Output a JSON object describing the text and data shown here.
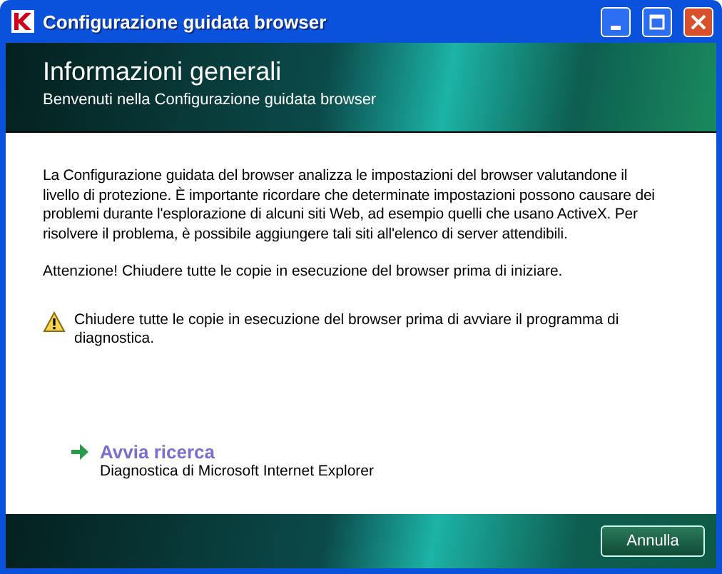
{
  "window": {
    "title": "Configurazione guidata browser"
  },
  "header": {
    "title": "Informazioni generali",
    "subtitle": "Benvenuti nella Configurazione guidata browser"
  },
  "body": {
    "intro": "La Configurazione guidata del browser analizza le impostazioni del browser valutandone il livello di protezione. È importante ricordare che determinate impostazioni possono causare dei problemi durante l'esplorazione di alcuni siti Web, ad esempio quelli che usano ActiveX. Per risolvere il problema, è possibile aggiungere tali siti all'elenco di server attendibili.",
    "attention": "Attenzione! Chiudere tutte le copie in esecuzione del browser prima di iniziare.",
    "warning": "Chiudere tutte le copie in esecuzione del browser prima di avviare il programma di diagnostica.",
    "action": {
      "label": "Avvia ricerca",
      "description": "Diagnostica di Microsoft Internet Explorer"
    }
  },
  "footer": {
    "buttons": [
      "Annulla"
    ]
  }
}
